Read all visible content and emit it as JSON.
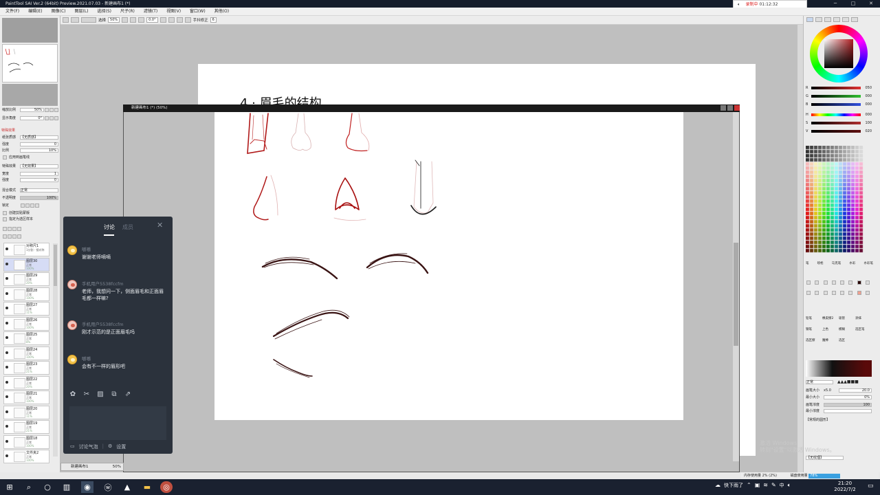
{
  "app": {
    "title": "PaintTool SAI Ver.2 (64bit) Preview.2021.07.03 - 新建画布1 (*)",
    "recording": {
      "label": "录制中",
      "time": "01:12:32"
    },
    "window_controls": [
      "─",
      "□",
      "✕"
    ]
  },
  "menu": [
    "文件(F)",
    "编辑(E)",
    "图像(C)",
    "图层(L)",
    "选择(S)",
    "尺子(R)",
    "滤镜(T)",
    "视图(V)",
    "窗口(W)",
    "其他(O)"
  ],
  "toolbar": {
    "select_label": "选择",
    "zoom": "50%",
    "rotation": "0.0°",
    "stabilizer_label": "手抖修正",
    "stabilizer_value": "6"
  },
  "left_panel": {
    "zoom_label": "缩放比例",
    "zoom_value": "50%",
    "angle_label": "显示角度",
    "angle_value": "0°",
    "special_effects": "特殊效果",
    "texture_label": "纸张质感",
    "texture_value": "【无质感】",
    "strength_label": "强度",
    "strength_value": "0",
    "scale_label": "比例",
    "scale_value": "10%",
    "apply_to_brush": "应用到画笔线",
    "effect_label": "特殊效果",
    "effect_value": "【无效果】",
    "width_label": "宽度",
    "width_value": "1",
    "intensity_label": "强度",
    "intensity_value": "0",
    "blend_label": "混合模式",
    "blend_value": "正常",
    "opacity_label": "不透明度",
    "opacity_value": "100%",
    "lock_label": "锁定",
    "clip_group": "创建剪贴蒙版",
    "sample_selection": "指定为选区样本"
  },
  "layers": [
    {
      "name": "对称尺1",
      "sub": "1分割 - 镜对称",
      "pct": ""
    },
    {
      "name": "图层30",
      "sub": "正常",
      "pct": "100%"
    },
    {
      "name": "图层29",
      "sub": "正常",
      "pct": "20%"
    },
    {
      "name": "图层28",
      "sub": "正常",
      "pct": "100%"
    },
    {
      "name": "图层27",
      "sub": "正常",
      "pct": "11%"
    },
    {
      "name": "图层26",
      "sub": "正常",
      "pct": "100%"
    },
    {
      "name": "图层25",
      "sub": "正常",
      "pct": "8%"
    },
    {
      "name": "图层24",
      "sub": "正常",
      "pct": "100%"
    },
    {
      "name": "图层23",
      "sub": "正常",
      "pct": "21%"
    },
    {
      "name": "图层22",
      "sub": "正常",
      "pct": "20%"
    },
    {
      "name": "图层21",
      "sub": "正常",
      "pct": "100%"
    },
    {
      "name": "图层20",
      "sub": "正常",
      "pct": "11%"
    },
    {
      "name": "图层19",
      "sub": "正常",
      "pct": "21%"
    },
    {
      "name": "图层18",
      "sub": "正常",
      "pct": "100%"
    },
    {
      "name": "文件夹2",
      "sub": "正常",
      "pct": "100%"
    }
  ],
  "canvas": {
    "heading": "4 · 眉毛的结构",
    "subwindow_title": "新建画布1 (*) (50%)",
    "bottom_tab": "新建画布1",
    "bottom_zoom": "50%"
  },
  "chat": {
    "tabs": [
      "讨论",
      "成员"
    ],
    "messages": [
      {
        "user": "嚼嚼",
        "text": "谢谢老师嘀嘀"
      },
      {
        "user": "手机用户5538fccfm",
        "text": "老师，我想问一下，侧面眉毛和正面眉毛都一样嘛?"
      },
      {
        "user": "手机用户5538fccfm",
        "text": "刚才示范的是正面眉毛吗"
      },
      {
        "user": "嚼嚼",
        "text": "会有不一样的眉形吧"
      }
    ],
    "footer_bubble": "讨论气泡",
    "footer_settings": "设置"
  },
  "right_panel": {
    "sliders": [
      {
        "label": "R",
        "value": "050",
        "color": "#e03030"
      },
      {
        "label": "G",
        "value": "000",
        "color": "#30c030"
      },
      {
        "label": "B",
        "value": "000",
        "color": "#3050e0"
      },
      {
        "label": "H",
        "value": "000",
        "color": "rainbow"
      },
      {
        "label": "S",
        "value": "100",
        "color": "#b03030"
      },
      {
        "label": "V",
        "value": "020",
        "color": "#601010"
      }
    ],
    "tools_row1": [
      "笔",
      "喷枪",
      "马克笔",
      "水彩",
      "水彩笔"
    ],
    "brush_size_label": "画笔大小",
    "brush_size_mult": "x5.0",
    "brush_size_value": "20.0",
    "min_size_label": "最小大小",
    "min_size_value": "0%",
    "density_label": "画笔浓度",
    "density_value": "100",
    "min_density_label": "最小浓度",
    "shape_label": "【常规的圆形】",
    "texture_label": "【无纹理】",
    "blend_mode": "正常",
    "tool_names": [
      "铅笔",
      "橡皮擦2",
      "吸管",
      "涂抹",
      "钢笔",
      "上色",
      "模糊",
      "选区笔",
      "选区擦",
      "魔棒",
      "选区"
    ]
  },
  "status": {
    "memory_label": "内存使用量",
    "memory_value": "2% (2%)",
    "disk_label": "磁盘使用量",
    "disk_value": "78%"
  },
  "watermark": {
    "line1": "激活 Windows",
    "line2": "转到\"设置\"以激活 Windows。"
  },
  "taskbar": {
    "weather": "快下雨了",
    "ime": "中",
    "time": "21:20",
    "date": "2022/7/2"
  }
}
